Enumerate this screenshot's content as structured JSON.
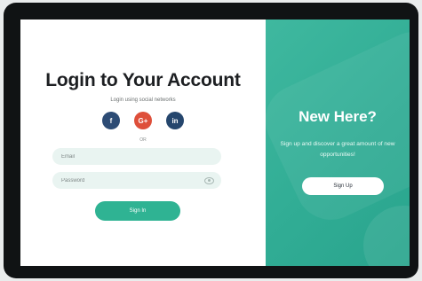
{
  "login": {
    "title": "Login to Your Account",
    "subtitle": "Login using social networks",
    "socials": [
      {
        "icon": "f",
        "name": "facebook",
        "color": "#2d4c75"
      },
      {
        "icon": "G+",
        "name": "google-plus",
        "color": "#de4f3a"
      },
      {
        "icon": "in",
        "name": "linkedin",
        "color": "#25466d"
      }
    ],
    "divider": "OR",
    "email_placeholder": "Email",
    "password_placeholder": "Password",
    "signin_label": "Sign In",
    "accent": "#2fb393"
  },
  "signup_panel": {
    "title": "New Here?",
    "description": "Sign up and discover a great amount of new opportunities!",
    "signup_label": "Sign Up",
    "background": "#37b39a"
  }
}
